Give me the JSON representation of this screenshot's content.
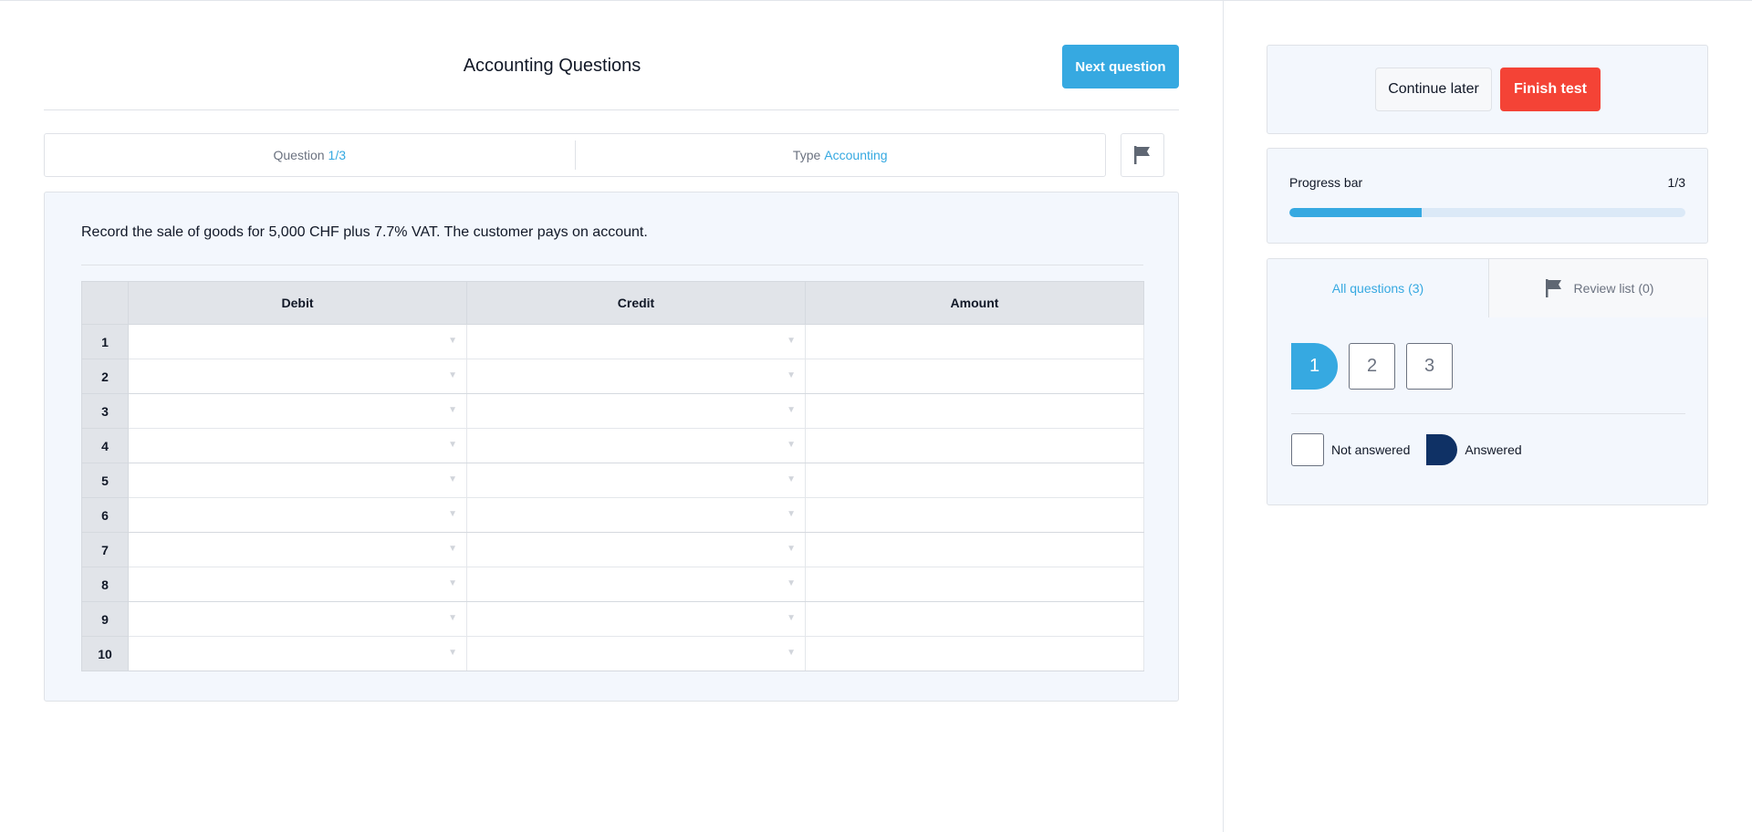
{
  "header": {
    "title": "Accounting Questions",
    "next_label": "Next question"
  },
  "info": {
    "question_label": "Question",
    "question_value": "1/3",
    "type_label": "Type",
    "type_value": "Accounting"
  },
  "question": {
    "text": "Record the sale of goods for 5,000 CHF plus 7.7% VAT. The customer pays on account.",
    "columns": [
      "Debit",
      "Credit",
      "Amount"
    ],
    "rows": [
      "1",
      "2",
      "3",
      "4",
      "5",
      "6",
      "7",
      "8",
      "9",
      "10"
    ]
  },
  "actions": {
    "continue_label": "Continue later",
    "finish_label": "Finish test"
  },
  "progress": {
    "label": "Progress bar",
    "count": "1/3",
    "fraction": 0.333
  },
  "questions_nav": {
    "tab_all": "All questions (3)",
    "tab_review": "Review list (0)",
    "items": [
      "1",
      "2",
      "3"
    ],
    "current": 1
  },
  "legend": {
    "not_answered": "Not answered",
    "answered": "Answered"
  },
  "colors": {
    "accent": "#36a9e1",
    "danger": "#f44336",
    "answered": "#0f3165"
  },
  "icons": {
    "flag": "flag-icon",
    "dropdown": "chevron-down-icon"
  }
}
